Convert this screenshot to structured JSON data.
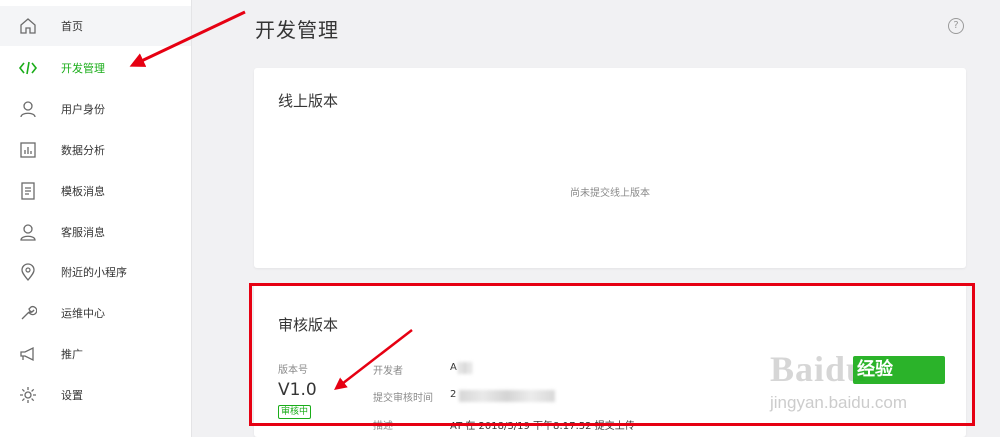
{
  "sidebar": {
    "items": [
      {
        "label": "首页",
        "icon": "home-icon"
      },
      {
        "label": "开发管理",
        "icon": "code-icon",
        "active": true
      },
      {
        "label": "用户身份",
        "icon": "user-icon"
      },
      {
        "label": "数据分析",
        "icon": "chart-icon"
      },
      {
        "label": "模板消息",
        "icon": "template-icon"
      },
      {
        "label": "客服消息",
        "icon": "customer-service-icon"
      },
      {
        "label": "附近的小程序",
        "icon": "location-icon"
      },
      {
        "label": "运维中心",
        "icon": "wrench-icon"
      },
      {
        "label": "推广",
        "icon": "megaphone-icon"
      },
      {
        "label": "设置",
        "icon": "gear-icon"
      }
    ]
  },
  "header": {
    "title": "开发管理",
    "help": "?"
  },
  "online_card": {
    "title": "线上版本",
    "empty_text": "尚未提交线上版本"
  },
  "review_card": {
    "title": "审核版本",
    "version_label": "版本号",
    "version": "V1.0",
    "status": "审核中",
    "developer_label": "开发者",
    "developer_value": "A",
    "submit_time_label": "提交审核时间",
    "submit_time_value": "2",
    "desc_label": "描述",
    "desc_value": "AT 在 2018/3/19 下午8:17:52 提交上传"
  },
  "watermark": {
    "brand": "Baidu",
    "badge": "经验",
    "url": "jingyan.baidu.com"
  },
  "colors": {
    "accent": "#1aad19",
    "annotation": "#e60012",
    "background": "#f1f1f3"
  }
}
